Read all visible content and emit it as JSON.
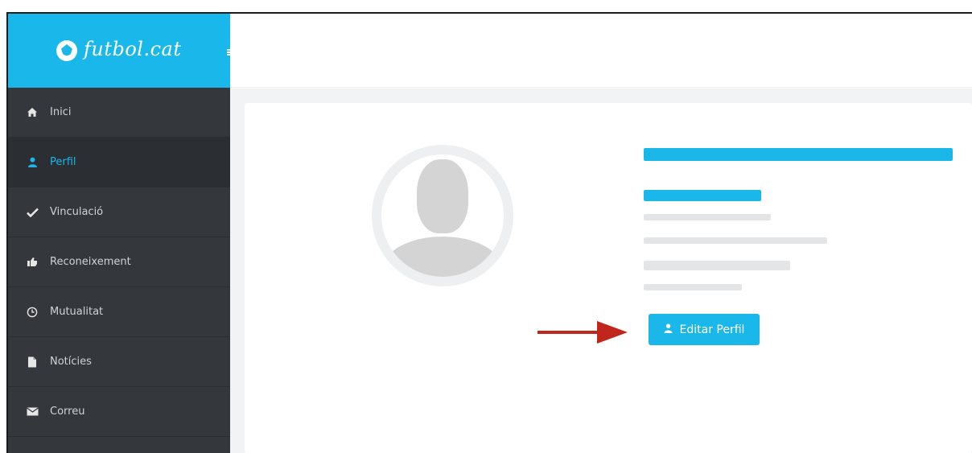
{
  "brand": {
    "logo_text": "futbol.cat"
  },
  "sidebar": {
    "items": [
      {
        "label": "Inici",
        "icon": "home-icon",
        "glyph": "🏠",
        "active": false
      },
      {
        "label": "Perfil",
        "icon": "user-icon",
        "glyph": "👤",
        "active": true
      },
      {
        "label": "Vinculació",
        "icon": "check-icon",
        "glyph": "✔",
        "active": false
      },
      {
        "label": "Reconeixement",
        "icon": "thumbs-up-icon",
        "glyph": "👍",
        "active": false
      },
      {
        "label": "Mutualitat",
        "icon": "clock-icon",
        "glyph": "◷",
        "active": false
      },
      {
        "label": "Notícies",
        "icon": "document-icon",
        "glyph": "▆",
        "active": false
      },
      {
        "label": "Correu",
        "icon": "envelope-icon",
        "glyph": "✉",
        "active": false
      }
    ]
  },
  "profile": {
    "edit_button_label": "Editar Perfil",
    "edit_button_icon": "user-icon",
    "edit_button_glyph": "👤"
  },
  "colors": {
    "accent": "#1ab7ea",
    "sidebar_bg": "#34383d",
    "arrow": "#c0261c"
  }
}
